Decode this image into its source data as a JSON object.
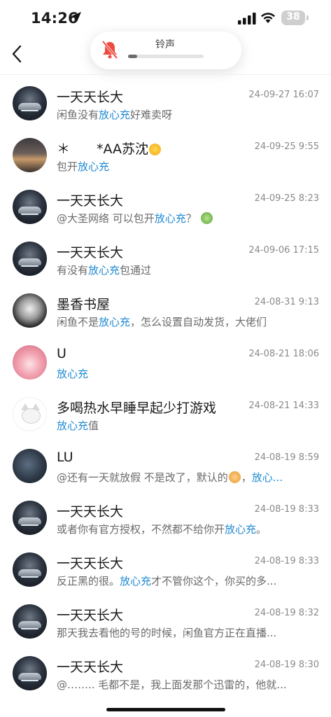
{
  "status_bar": {
    "time": "14:26",
    "battery": "38"
  },
  "ringer": {
    "label": "铃声",
    "level": 0.12
  },
  "conversations": [
    {
      "avatar": "car",
      "name": "一天天长大",
      "date": "24-09-27 16:07",
      "message": [
        {
          "t": "闲鱼没有"
        },
        {
          "t": "放心充",
          "hl": true
        },
        {
          "t": "好难卖呀"
        }
      ]
    },
    {
      "avatar": "dusk",
      "name_parts": [
        {
          "t": "＊　　*AA苏沈"
        },
        {
          "emoji": "sun"
        }
      ],
      "date": "24-09-25 9:55",
      "message": [
        {
          "t": "包开"
        },
        {
          "t": "放心充",
          "hl": true
        }
      ]
    },
    {
      "avatar": "car",
      "name": "一天天长大",
      "date": "24-09-25 8:23",
      "message": [
        {
          "t": "@大圣网络 可以包开"
        },
        {
          "t": "放心充",
          "hl": true
        },
        {
          "t": "？ "
        },
        {
          "emoji": "frog"
        }
      ]
    },
    {
      "avatar": "car",
      "name": "一天天长大",
      "date": "24-09-06 17:15",
      "message": [
        {
          "t": "有没有"
        },
        {
          "t": "放心充",
          "hl": true
        },
        {
          "t": "包通过"
        }
      ]
    },
    {
      "avatar": "man",
      "name": "墨香书屋",
      "date": "24-08-31 9:13",
      "message": [
        {
          "t": "闲鱼不是"
        },
        {
          "t": "放心充",
          "hl": true
        },
        {
          "t": "，怎么设置自动发货，大佬们"
        }
      ]
    },
    {
      "avatar": "anime",
      "name": "U",
      "date": "24-08-21 18:06",
      "message": [
        {
          "t": "放心充",
          "hl": true
        }
      ]
    },
    {
      "avatar": "cat",
      "name": "多喝热水早睡早起少打游戏",
      "date": "24-08-21 14:33",
      "message": [
        {
          "t": "放心充",
          "hl": true
        },
        {
          "t": "值"
        }
      ]
    },
    {
      "avatar": "lu",
      "name": "LU",
      "date": "24-08-19 8:59",
      "message": [
        {
          "t": "@还有一天就放假 不是改了，默认的"
        },
        {
          "emoji": "tiger"
        },
        {
          "t": "，"
        },
        {
          "t": "放心...",
          "hl": true
        }
      ]
    },
    {
      "avatar": "car",
      "name": "一天天长大",
      "date": "24-08-19 8:33",
      "message": [
        {
          "t": "或者你有官方授权，不然都不给你开"
        },
        {
          "t": "放心充",
          "hl": true
        },
        {
          "t": "。"
        }
      ]
    },
    {
      "avatar": "car",
      "name": "一天天长大",
      "date": "24-08-19 8:33",
      "message": [
        {
          "t": "反正黑的很。"
        },
        {
          "t": "放心充",
          "hl": true
        },
        {
          "t": "才不管你这个，你买的多..."
        }
      ]
    },
    {
      "avatar": "car",
      "name": "一天天长大",
      "date": "24-08-19 8:32",
      "message": [
        {
          "t": "那天我去看他的号的时候，闲鱼官方正在直播..."
        }
      ]
    },
    {
      "avatar": "car",
      "name": "一天天长大",
      "date": "24-08-19 8:30",
      "message": [
        {
          "t": "@…….. 毛都不是，我上面发那个迅雷的，他就..."
        }
      ]
    }
  ],
  "colors": {
    "highlight": "#1f8ad2",
    "date": "#8a8a8a",
    "message": "#6a6a6a"
  }
}
